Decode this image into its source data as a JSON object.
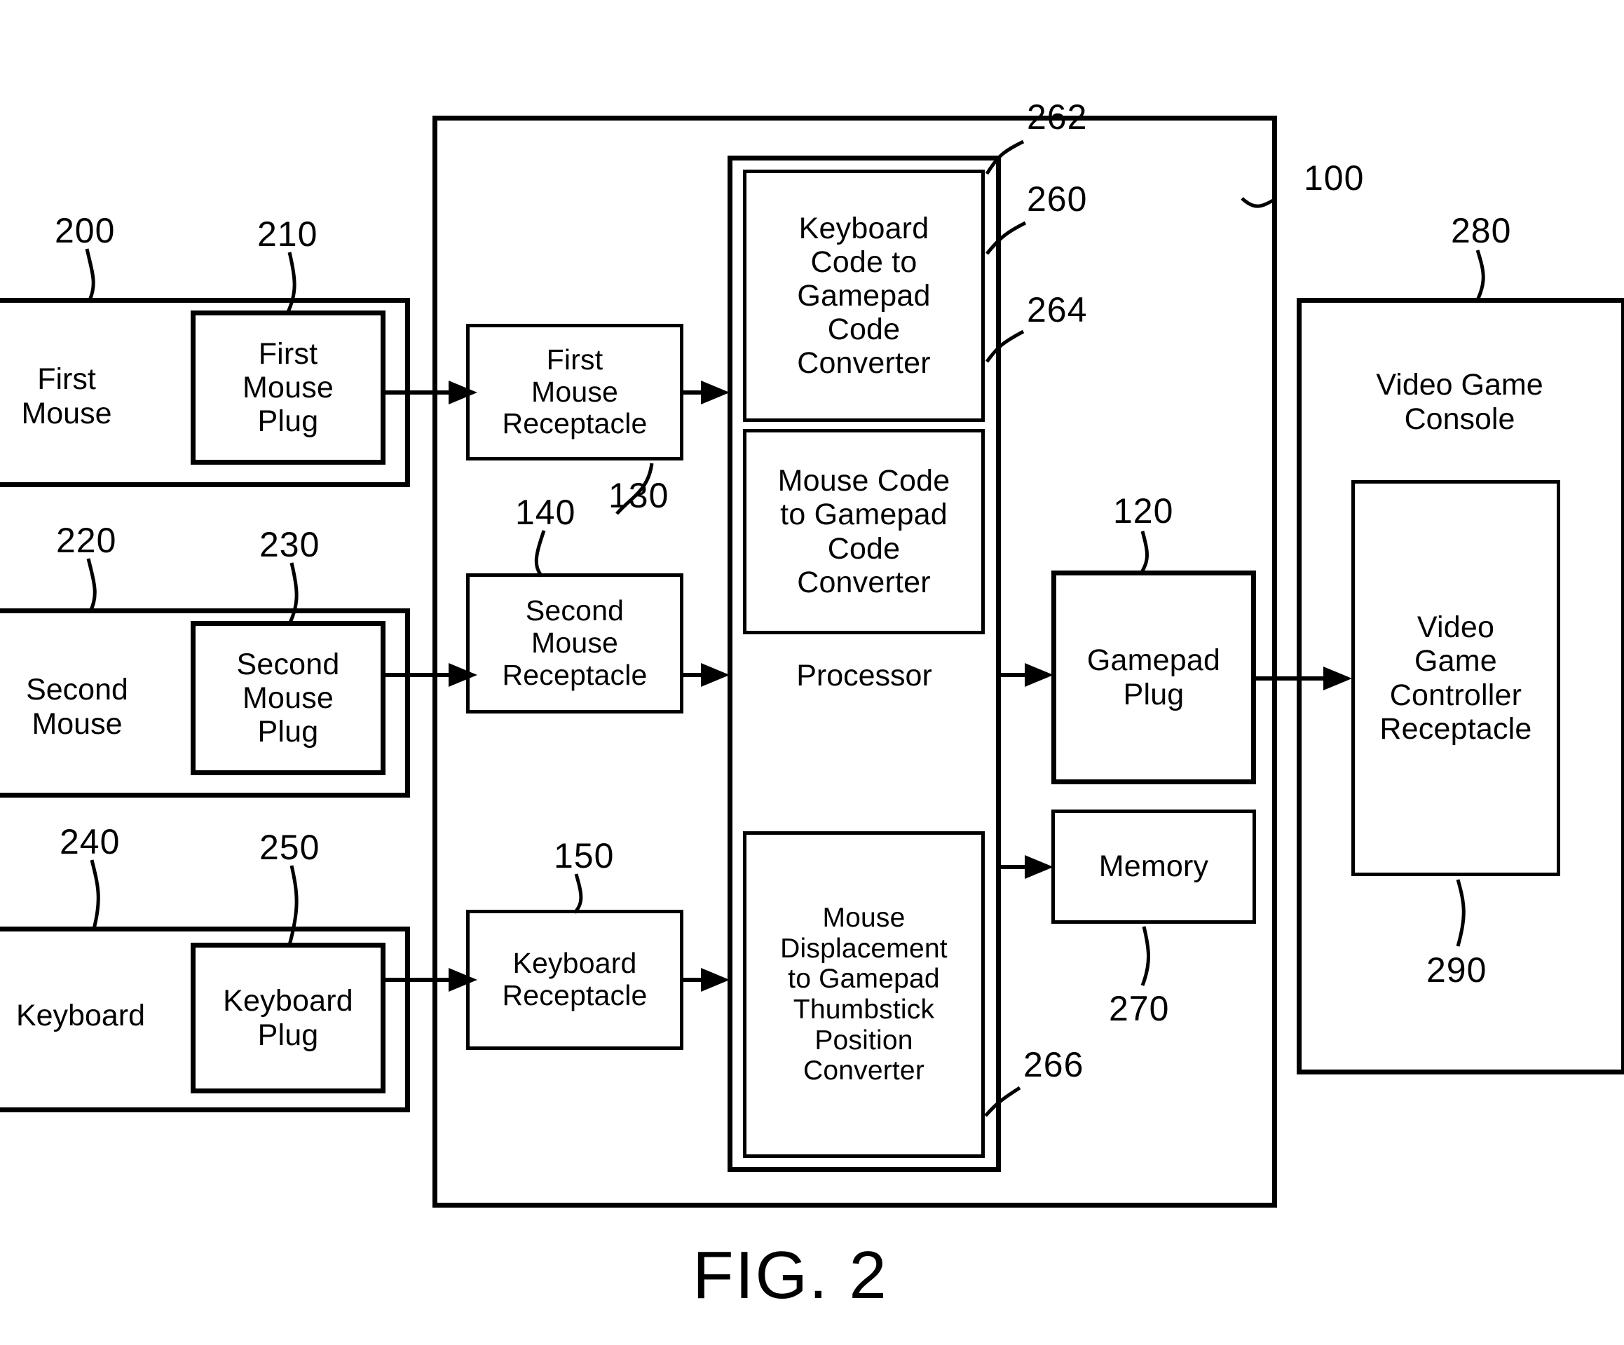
{
  "figure": {
    "caption": "FIG. 2",
    "title": "Mouse and keyboard to gamepad adapter block diagram"
  },
  "devices": {
    "first_mouse": {
      "label": "First\nMouse",
      "ref": "200"
    },
    "first_mouse_plug": {
      "label": "First\nMouse\nPlug",
      "ref": "210"
    },
    "second_mouse": {
      "label": "Second\nMouse",
      "ref": "220"
    },
    "second_mouse_plug": {
      "label": "Second\nMouse\nPlug",
      "ref": "230"
    },
    "keyboard": {
      "label": "Keyboard",
      "ref": "240"
    },
    "keyboard_plug": {
      "label": "Keyboard\nPlug",
      "ref": "250"
    }
  },
  "adapter": {
    "ref": "100",
    "first_mouse_receptacle": {
      "label": "First\nMouse\nReceptacle",
      "ref": "130"
    },
    "second_mouse_receptacle": {
      "label": "Second\nMouse\nReceptacle",
      "ref": "140"
    },
    "keyboard_receptacle": {
      "label": "Keyboard\nReceptacle",
      "ref": "150"
    },
    "processor": {
      "label": "Processor",
      "ref": "260"
    },
    "keyboard_code_converter": {
      "label": "Keyboard\nCode to\nGamepad\nCode\nConverter",
      "ref": "262"
    },
    "mouse_code_converter": {
      "label": "Mouse Code\nto Gamepad\nCode\nConverter",
      "ref": "264"
    },
    "mouse_displacement_converter": {
      "label": "Mouse\nDisplacement\nto Gamepad\nThumbstick\nPosition\nConverter",
      "ref": "266"
    },
    "gamepad_plug": {
      "label": "Gamepad\nPlug",
      "ref": "120"
    },
    "memory": {
      "label": "Memory",
      "ref": "270"
    }
  },
  "console": {
    "label": "Video Game\nConsole",
    "ref": "280",
    "controller_receptacle": {
      "label": "Video\nGame\nController\nReceptacle",
      "ref": "290"
    }
  },
  "colors": {
    "line": "#000000",
    "background": "#ffffff"
  }
}
